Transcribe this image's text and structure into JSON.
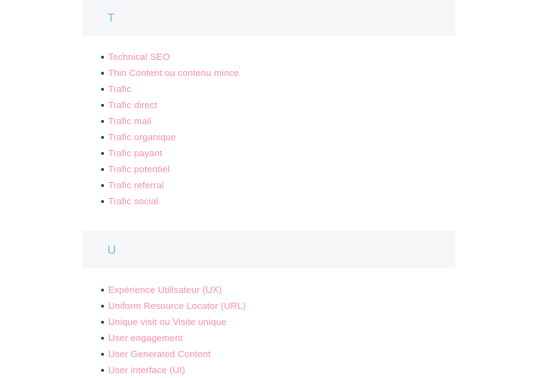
{
  "page": {
    "type": "glossary-index",
    "background_color": "#ffffff",
    "link_color": "#fa8cb4",
    "heading_color": "#6ec7bd",
    "band_color": "#f5f6f8",
    "bullet_color": "#3c3c3c"
  },
  "sections": [
    {
      "letter": "T",
      "terms": [
        "Technical SEO",
        "Thin Content ou contenu mince",
        "Trafic",
        "Trafic direct",
        "Trafic mail",
        "Trafic organique",
        "Trafic payant",
        "Trafic potentiel",
        "Trafic referral",
        "Trafic social"
      ]
    },
    {
      "letter": "U",
      "terms": [
        "Expérience Utilisateur (UX)",
        "Uniform Resource Locator (URL)",
        "Unique visit ou Visite unique",
        "User engagement",
        "User Generated Content",
        "User interface (UI)"
      ]
    }
  ]
}
